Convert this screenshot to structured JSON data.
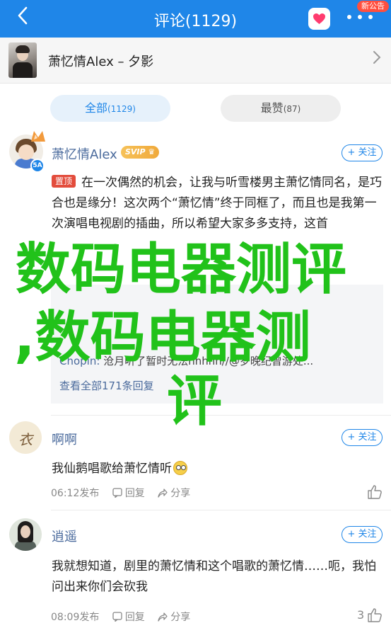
{
  "topbar": {
    "back_icon": "back-chevron-icon",
    "title": "评论(1129)",
    "heart_icon": "heart-icon",
    "more_icon": "more-dots-icon",
    "badge": "新公告",
    "color": "#1f86e8"
  },
  "article": {
    "title": "萧忆情Alex – 夕影",
    "chevron_icon": "chevron-right-icon"
  },
  "tabs": [
    {
      "label": "全部",
      "count": "(1129)",
      "active": true
    },
    {
      "label": "最赞",
      "count": "(87)",
      "active": false
    }
  ],
  "comments": [
    {
      "user": "萧忆情Alex",
      "vip": "SVIP",
      "badge": "5A",
      "follow": "+ 关注",
      "pin_label": "置顶",
      "text": "在一次偶然的机会，让我与听雪楼男主萧忆情同名，是巧合也是缘分！这次两个“萧忆情”终于同框了，而且也是我第一次演唱电视剧的插曲，所以希望大家多多支持，这首",
      "replies": [
        {
          "name": "Chopin:",
          "text": "沧月听了暂时无法hhhhh//@岁晚纪曾游处..."
        }
      ],
      "more_replies": "查看全部171条回复"
    },
    {
      "user": "啊啊",
      "follow": "+ 关注",
      "text": "我仙鹅唱歌给萧忆情听",
      "time": "06:12发布",
      "reply": "回复",
      "share": "分享"
    },
    {
      "user": "逍遥",
      "follow": "+ 关注",
      "text": "我就想知道，剧里的萧忆情和这个唱歌的萧忆情……呃，我怕问出来你们会砍我",
      "time": "08:09发布",
      "reply": "回复",
      "share": "分享",
      "likes": "3"
    }
  ],
  "watermark": {
    "line1": "数码电器测评",
    "line2": ",数码电器测",
    "line3": "评",
    "color": "#21c21a"
  }
}
